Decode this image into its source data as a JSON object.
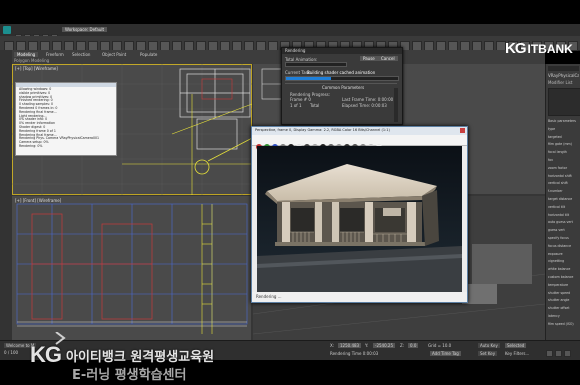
{
  "app": {
    "title": "Workspace: Default"
  },
  "menu": {
    "items": [
      "Edit",
      "Tools",
      "Group",
      "Views",
      "Create",
      "Modifiers",
      "Animation",
      "Graph Editors",
      "Rendering",
      "Customize",
      "MAXScript",
      "Help"
    ]
  },
  "ribbon": {
    "tab_modeling": "Modeling",
    "tab_freeform": "Freeform",
    "tab_selection": "Selection",
    "tab_object_paint": "Object Paint",
    "tab_populate": "Populate",
    "sub_label": "Polygon Modeling"
  },
  "viewports": {
    "top_label": "[+] [Top] [Wireframe]",
    "front_label": "[+] [Front] [Wireframe]",
    "persp_label": "[+] [Perspective] [Shaded]"
  },
  "progress_dialog": {
    "title": "Rendering",
    "total_animation_label": "Total Animation:",
    "current_task_label": "Current Task:",
    "current_task_value": "Building shader cached animation",
    "pause_button": "Pause",
    "cancel_button": "Cancel",
    "common_params_header": "Common Parameters",
    "rendering_progress_label": "Rendering Progress:",
    "frame_label": "Frame #  0",
    "last_frame_time": "Last Frame Time: 0:00:00",
    "elapsed_time": "Elapsed Time: 0:00:03",
    "of_label": "1 of  1",
    "total_label": "Total"
  },
  "render_window": {
    "title": "Perspective, frame 0, Display Gamma: 2.2, RGBA Color 16 Bits/Channel (1:1)",
    "area_label": "Area to Render:",
    "viewport_label": "Viewport:",
    "channel_label": "RGB Alpha",
    "bottom_status": "Rendering ...",
    "swatch_colors": [
      "#c03030",
      "#2f8f2f",
      "#3050c0",
      "#7a7a7a",
      "#1a1a1a",
      "#e0e0e0",
      "#404040",
      "#a0a0a0",
      "#202020",
      "#606060",
      "#909090",
      "#303030",
      "#505050",
      "#808080",
      "#c0c0c0",
      "#e8e8e8"
    ]
  },
  "log_window": {
    "lines": [
      "Allowing windows: 0",
      "visible primitives: 0",
      "shadow primitives: 0",
      "Finished rendering: 0",
      "0 shading samples: 0",
      "Rendered 0 frames in: 0",
      "Rendering final frame...",
      "",
      "Light rendering...",
      "0% shader info: 0",
      "0% render information",
      "Shader digest: 0",
      "Rendering frame 0 of 1",
      "Rendering final frame...",
      "Rendering Phys. Camera VRayPhysicalCamera001",
      "Camera setup: 0%",
      "Rendering: 0%"
    ]
  },
  "command_panel": {
    "modifier_list": "Modifier List",
    "object_name": "VRayPhysicalCamera001",
    "rows": [
      "Basic parameters",
      "type",
      "targeted",
      "film gate (mm)",
      "focal length",
      "fov",
      "zoom factor",
      "horizontal shift",
      "vertical shift",
      "f-number",
      "target distance",
      "vertical tilt",
      "horizontal tilt",
      "auto guess vert",
      "guess vert",
      "specify focus",
      "focus distance",
      "exposure",
      "vignetting",
      "white balance",
      "custom balance",
      "temperature",
      "shutter speed",
      "shutter angle",
      "shutter offset",
      "latency",
      "film speed (ISO)"
    ]
  },
  "status": {
    "selected": "1 Camera Selected",
    "prompt": "Rendering Time 0:00:03",
    "welcome": "Welcome to M",
    "frame_counter": "0 / 100",
    "x_label": "X:",
    "y_label": "Y:",
    "z_label": "Z:",
    "x_value": "1250.483",
    "y_value": "-2540.25",
    "z_value": "0.0",
    "grid": "Grid = 10.0",
    "auto_key": "Auto Key",
    "set_key": "Set Key",
    "selected_dropdown": "Selected",
    "add_time_tag": "Add Time Tag",
    "key_filters": "Key Filters..."
  },
  "branding": {
    "top_logo_kg": "KG",
    "top_logo_text": "ITBANK",
    "watermark_kg": "KG",
    "watermark_line1": "아이티뱅크 원격평생교육원",
    "watermark_line2": "E-러닝 평생학습센터"
  },
  "colors": {
    "viewport_bg": "#4a4a4a",
    "wire_yellow": "#e8e23a",
    "wire_blue": "#4a6bd8",
    "wire_white": "#dcdcdc",
    "wire_red": "#c83a3a",
    "accent_blue": "#1f7fd8"
  }
}
